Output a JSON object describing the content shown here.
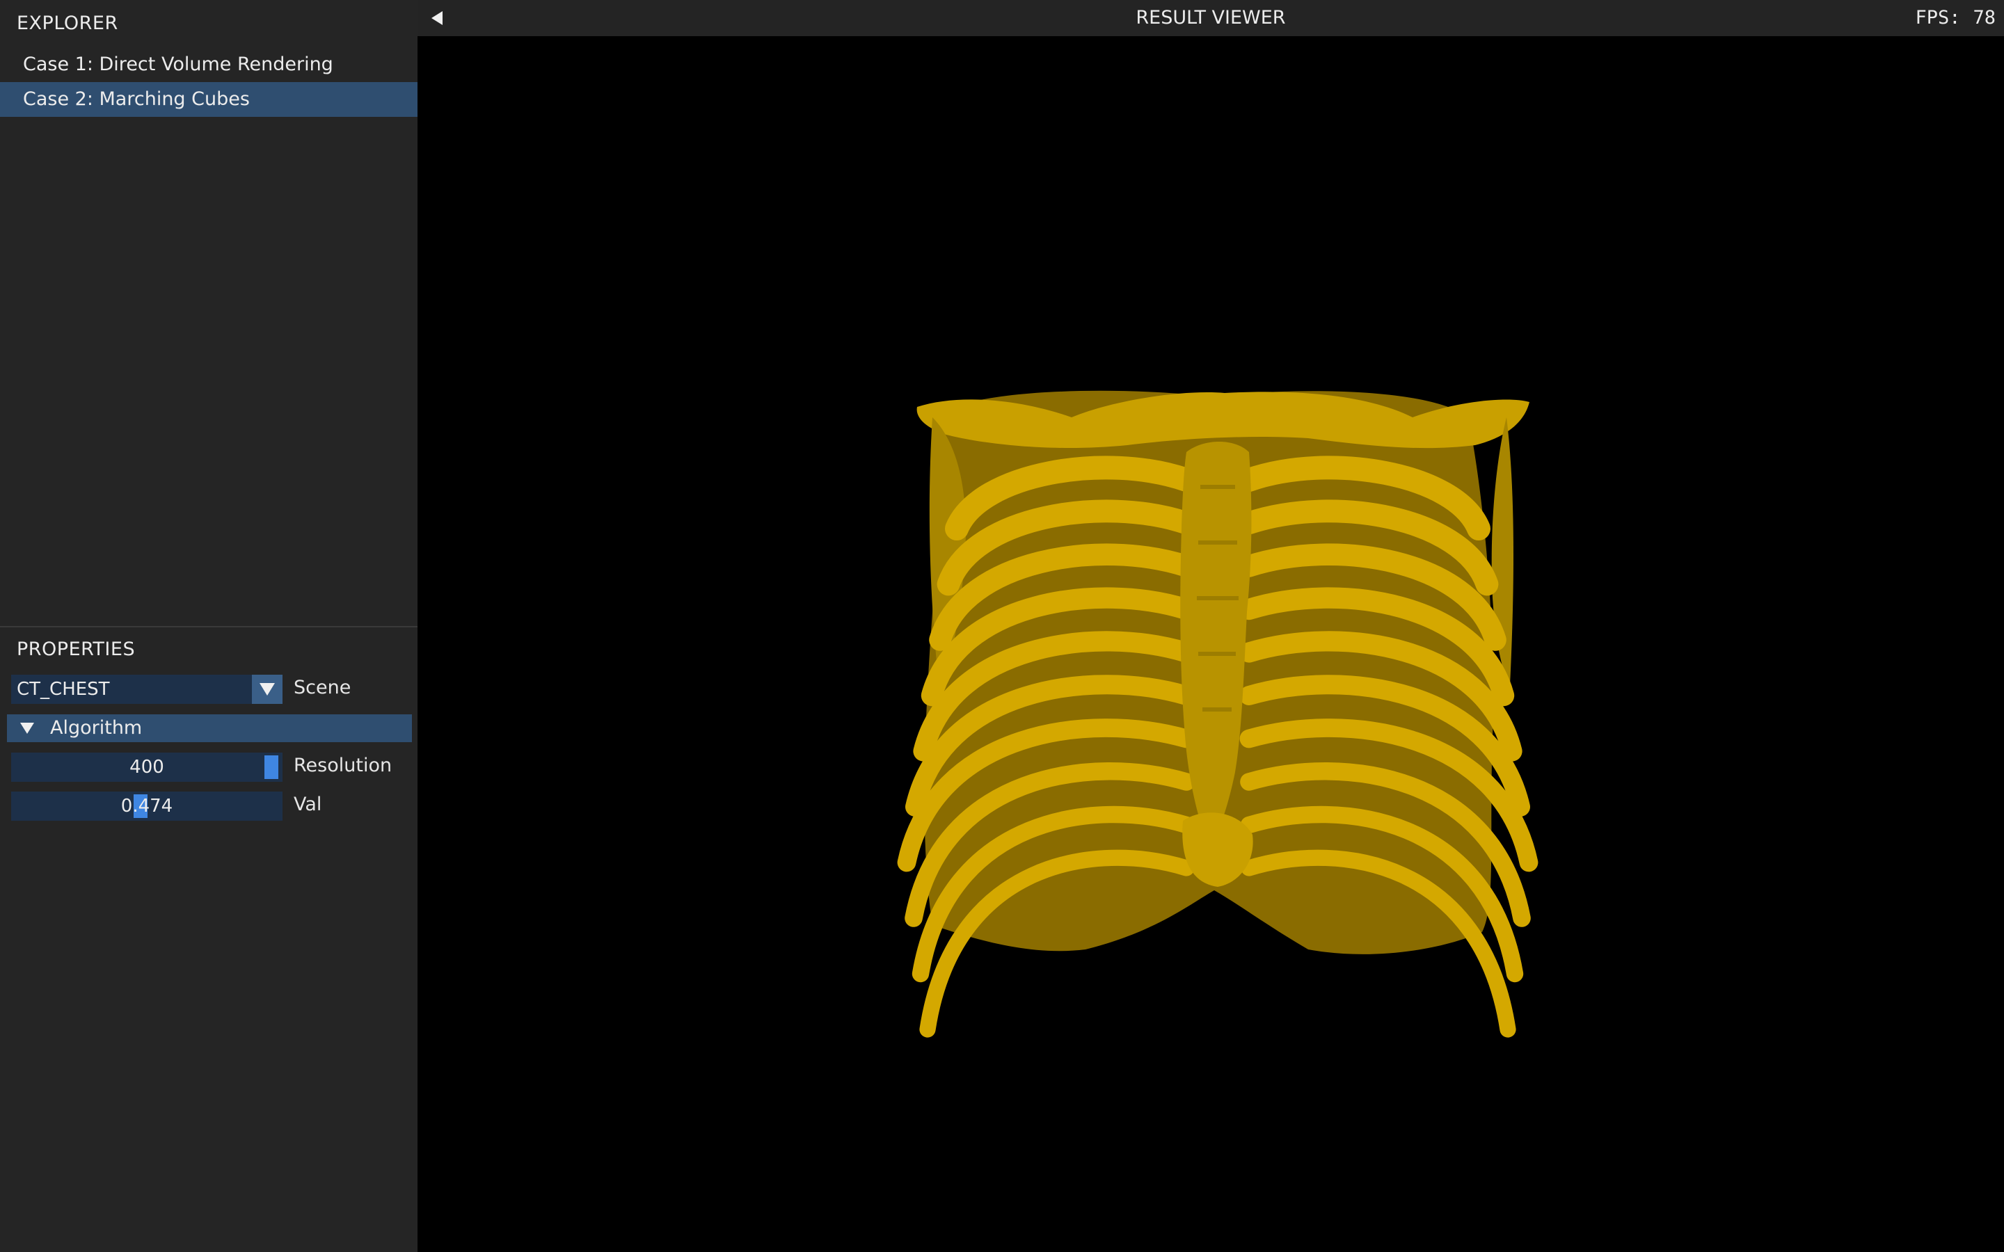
{
  "explorer": {
    "title": "EXPLORER",
    "cases": [
      {
        "label": "Case 1: Direct Volume Rendering",
        "selected": false
      },
      {
        "label": "Case 2: Marching Cubes",
        "selected": true
      }
    ]
  },
  "properties": {
    "title": "PROPERTIES",
    "scene": {
      "value": "CT_CHEST",
      "label": "Scene"
    },
    "algorithm": {
      "label": "Algorithm",
      "expanded": true
    },
    "resolution": {
      "value": "400",
      "label": "Resolution"
    },
    "val": {
      "value": "0.474",
      "label": "Val"
    }
  },
  "viewer": {
    "title": "RESULT VIEWER",
    "fps_label": "FPS:",
    "fps_value": "78",
    "render_color": "#d4a800"
  },
  "colors": {
    "panel_bg": "#252525",
    "selection": "#2f4e70",
    "widget_bg": "#1d3049",
    "accent": "#3f86e2",
    "viewport_bg": "#000000"
  }
}
